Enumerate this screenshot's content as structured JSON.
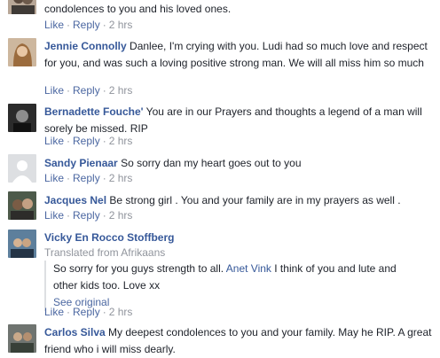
{
  "actions": {
    "like": "Like",
    "reply": "Reply",
    "separator": "·"
  },
  "comments": [
    {
      "text": "condolences to you and his loved ones.",
      "time": "2 hrs"
    },
    {
      "name": "Jennie Connolly",
      "text": "Danlee, I'm crying with you. Ludi had so much love and respect for you, and was such a loving positive strong man. We will all miss him so much",
      "time": "2 hrs"
    },
    {
      "name": "Bernadette Fouche'",
      "text": "You are in our Prayers and thoughts a legend of a man will sorely be missed. RIP",
      "time": "2 hrs"
    },
    {
      "name": "Sandy Pienaar",
      "text": "So sorry dan my heart goes out to you",
      "time": "2 hrs"
    },
    {
      "name": "Jacques Nel",
      "text": "Be strong girl . You and your family are in my prayers as well .",
      "time": "2 hrs"
    },
    {
      "name": "Vicky En Rocco Stoffberg",
      "translated_from": "Translated from Afrikaans",
      "text_before": "So sorry for you guys strength to all.",
      "mention": "Anet Vink",
      "text_after": "I think of you and lute and other kids too. Love xx",
      "see_original": "See original",
      "time": "2 hrs"
    },
    {
      "name": "Carlos Silva",
      "text": "My deepest condolences to you and your family. May he RIP. A great friend who i will miss dearly."
    }
  ]
}
